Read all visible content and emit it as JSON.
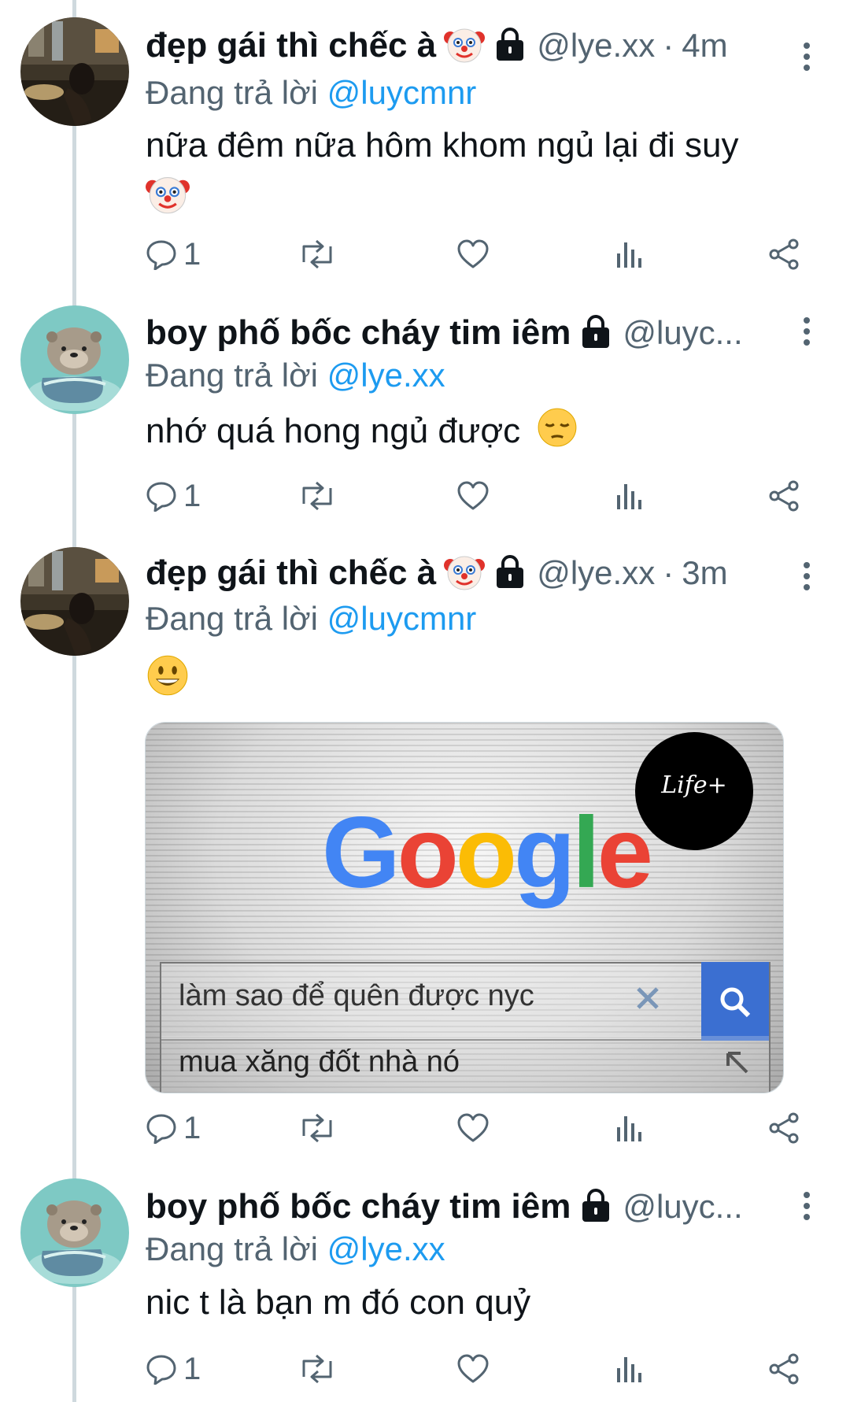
{
  "colors": {
    "link": "#1d9bf0",
    "muted": "#536471",
    "thread_line": "#cfd9de",
    "google_blue": "#4285f4",
    "google_red": "#ea4335",
    "google_yellow": "#fbbc05",
    "google_green": "#34a853"
  },
  "tweets": [
    {
      "display_name": "đẹp gái thì chếc à",
      "name_emoji": "clown-face-icon",
      "handle": "@lye.xx",
      "separator": "·",
      "time": "4m",
      "reply_prefix": "Đang trả lời",
      "reply_mention": "@luycmnr",
      "text": "nữa đêm nữa hôm khom ngủ lại đi suy",
      "text_emoji": "clown-face-icon",
      "reply_count": "1"
    },
    {
      "display_name": "boy phố bốc cháy tim iêm",
      "handle": "@luyc...",
      "reply_prefix": "Đang trả lời",
      "reply_mention": "@lye.xx",
      "text": "nhớ quá hong ngủ được",
      "text_emoji": "pensive-face-icon",
      "reply_count": "1"
    },
    {
      "display_name": "đẹp gái thì chếc à",
      "name_emoji": "clown-face-icon",
      "handle": "@lye.xx",
      "separator": "·",
      "time": "3m",
      "reply_prefix": "Đang trả lời",
      "reply_mention": "@luycmnr",
      "text_emoji": "grinning-face-icon",
      "media": {
        "logo": "Google",
        "badge": "Life+",
        "search_query": "làm sao để quên được nyc",
        "suggestion": "mua xăng đốt nhà nó"
      },
      "reply_count": "1"
    },
    {
      "display_name": "boy phố bốc cháy tim iêm",
      "handle": "@luyc...",
      "reply_prefix": "Đang trả lời",
      "reply_mention": "@lye.xx",
      "text": "nic t là bạn m đó con quỷ",
      "reply_count": "1"
    }
  ]
}
